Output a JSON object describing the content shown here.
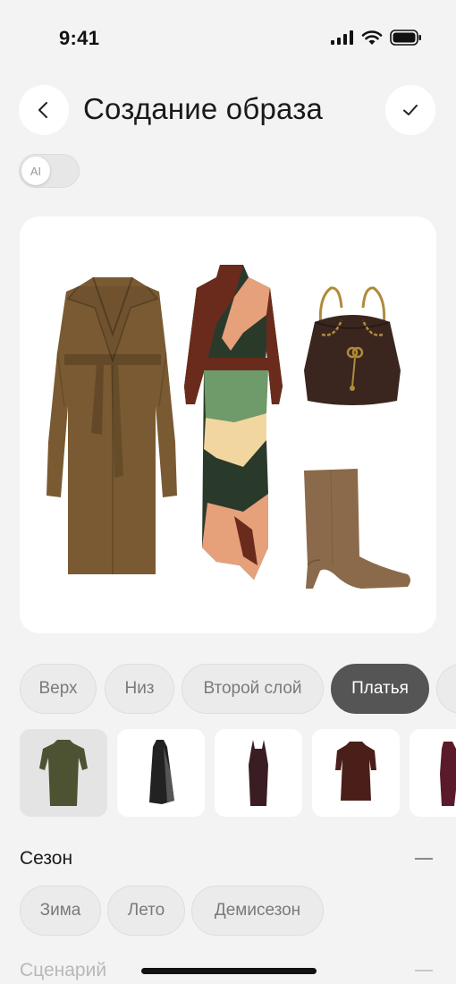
{
  "status_bar": {
    "time": "9:41"
  },
  "header": {
    "title": "Создание образа"
  },
  "ai_toggle": {
    "label": "AI",
    "enabled": false
  },
  "category_tabs": [
    {
      "label": "Верх",
      "active": false
    },
    {
      "label": "Низ",
      "active": false
    },
    {
      "label": "Второй слой",
      "active": false
    },
    {
      "label": "Платья",
      "active": true
    },
    {
      "label": "",
      "active": false
    }
  ],
  "canvas_items": [
    {
      "name": "coat",
      "color": "#7a5a32"
    },
    {
      "name": "dress",
      "colors": [
        "#6a2a1c",
        "#e6a07a",
        "#6f9a6a",
        "#2a3a2a",
        "#f1d6a0"
      ]
    },
    {
      "name": "bag",
      "color": "#3a261f",
      "hardware_color": "#b08a3a"
    },
    {
      "name": "boot",
      "color": "#8a6a4a"
    }
  ],
  "dress_items": [
    {
      "color": "#4d5233",
      "selected": true
    },
    {
      "color": "#222222",
      "selected": false
    },
    {
      "color": "#3a1d22",
      "selected": false
    },
    {
      "color": "#4a1f1a",
      "selected": false
    },
    {
      "color": "#5a1a2a",
      "selected": false
    }
  ],
  "season": {
    "title": "Сезон",
    "chips": [
      "Зима",
      "Лето",
      "Демисезон"
    ]
  },
  "scenario": {
    "title": "Сценарий"
  }
}
